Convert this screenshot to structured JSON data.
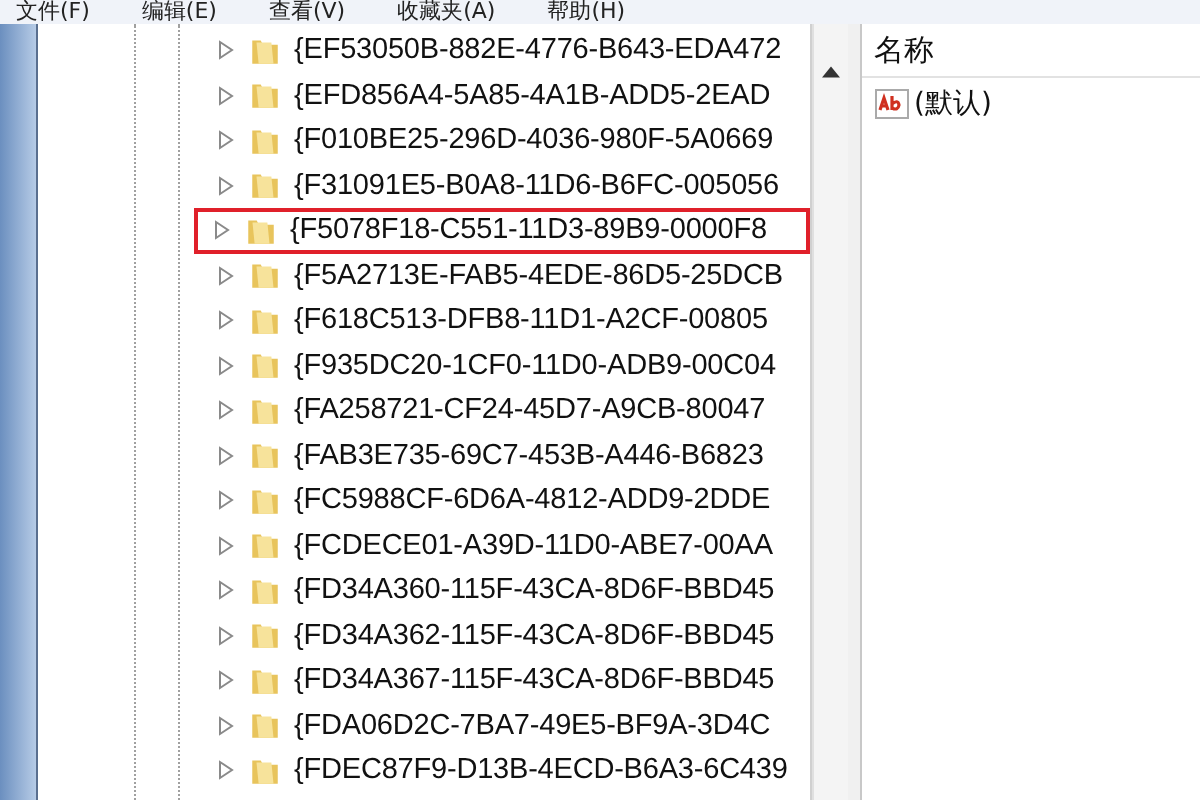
{
  "menu": [
    "文件(F)",
    "编辑(E)",
    "查看(V)",
    "收藏夹(A)",
    "帮助(H)"
  ],
  "tree": {
    "items": [
      {
        "label": "{EF53050B-882E-4776-B643-EDA472",
        "expanded": false,
        "marked": false
      },
      {
        "label": "{EFD856A4-5A85-4A1B-ADD5-2EAD",
        "expanded": false,
        "marked": false
      },
      {
        "label": "{F010BE25-296D-4036-980F-5A0669",
        "expanded": false,
        "marked": false
      },
      {
        "label": "{F31091E5-B0A8-11D6-B6FC-005056",
        "expanded": false,
        "marked": false
      },
      {
        "label": "{F5078F18-C551-11D3-89B9-0000F8",
        "expanded": false,
        "marked": true
      },
      {
        "label": "{F5A2713E-FAB5-4EDE-86D5-25DCB",
        "expanded": false,
        "marked": false
      },
      {
        "label": "{F618C513-DFB8-11D1-A2CF-00805",
        "expanded": false,
        "marked": false
      },
      {
        "label": "{F935DC20-1CF0-11D0-ADB9-00C04",
        "expanded": false,
        "marked": false
      },
      {
        "label": "{FA258721-CF24-45D7-A9CB-80047",
        "expanded": false,
        "marked": false
      },
      {
        "label": "{FAB3E735-69C7-453B-A446-B6823",
        "expanded": false,
        "marked": false
      },
      {
        "label": "{FC5988CF-6D6A-4812-ADD9-2DDE",
        "expanded": false,
        "marked": false
      },
      {
        "label": "{FCDECE01-A39D-11D0-ABE7-00AA",
        "expanded": false,
        "marked": false
      },
      {
        "label": "{FD34A360-115F-43CA-8D6F-BBD45",
        "expanded": false,
        "marked": false
      },
      {
        "label": "{FD34A362-115F-43CA-8D6F-BBD45",
        "expanded": false,
        "marked": false
      },
      {
        "label": "{FD34A367-115F-43CA-8D6F-BBD45",
        "expanded": false,
        "marked": false
      },
      {
        "label": "{FDA06D2C-7BA7-49E5-BF9A-3D4C",
        "expanded": false,
        "marked": false
      },
      {
        "label": "{FDEC87F9-D13B-4ECD-B6A3-6C439",
        "expanded": false,
        "marked": false
      }
    ]
  },
  "values": {
    "columns": [
      "名称"
    ],
    "rows": [
      {
        "name": "(默认)"
      }
    ]
  }
}
